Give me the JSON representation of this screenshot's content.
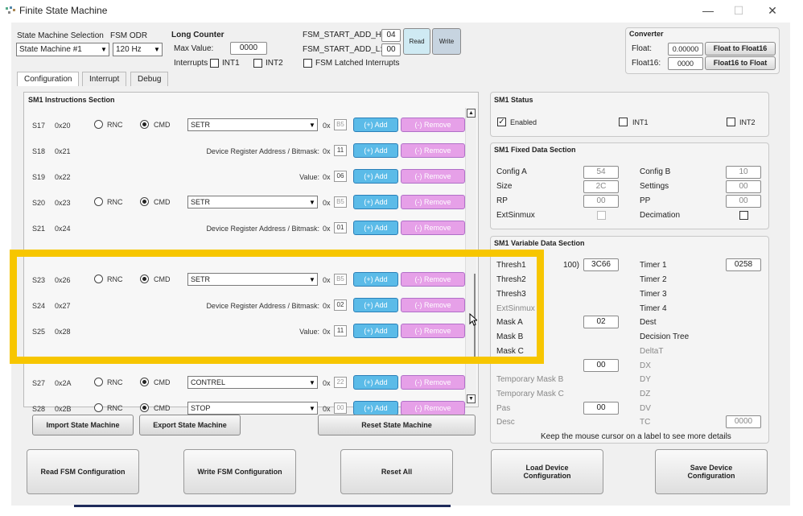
{
  "window": {
    "title": "Finite State Machine",
    "minimize": "—",
    "maximize": "☐",
    "close": "✕"
  },
  "top": {
    "sm_selection_label": "State Machine Selection",
    "sm_selection_value": "State Machine #1",
    "fsm_odr_label": "FSM ODR",
    "fsm_odr_value": "120 Hz",
    "long_counter_label": "Long Counter",
    "max_value_label": "Max Value:",
    "max_value": "0000",
    "interrupts_label": "Interrupts",
    "int1": "INT1",
    "int2": "INT2",
    "start_add_h_label": "FSM_START_ADD_H:",
    "start_add_h": "04",
    "start_add_l_label": "FSM_START_ADD_L:",
    "start_add_l": "00",
    "read_label": "Read",
    "write_label": "Write",
    "latched_label": "FSM Latched Interrupts",
    "converter_label": "Converter",
    "float_label": "Float:",
    "float_value": "0.00000",
    "float_btn": "Float to Float16",
    "float16_label": "Float16:",
    "float16_value": "0000",
    "float16_btn": "Float16 to Float"
  },
  "tabs": [
    "Configuration",
    "Interrupt",
    "Debug"
  ],
  "instructions": {
    "title": "SM1 Instructions Section",
    "rows": [
      {
        "id": "S17",
        "addr": "0x20",
        "type": "cmd",
        "cmd": "SETR",
        "hex": "B5"
      },
      {
        "id": "S18",
        "addr": "0x21",
        "type": "field",
        "field": "Device Register Address / Bitmask:",
        "hex": "11"
      },
      {
        "id": "S19",
        "addr": "0x22",
        "type": "field",
        "field": "Value:",
        "hex": "06"
      },
      {
        "id": "S20",
        "addr": "0x23",
        "type": "cmd",
        "cmd": "SETR",
        "hex": "B5"
      },
      {
        "id": "S21",
        "addr": "0x24",
        "type": "field",
        "field": "Device Register Address / Bitmask:",
        "hex": "01"
      },
      {
        "id": "S23",
        "addr": "0x26",
        "type": "cmd",
        "cmd": "SETR",
        "hex": "B5"
      },
      {
        "id": "S24",
        "addr": "0x27",
        "type": "field",
        "field": "Device Register Address / Bitmask:",
        "hex": "02"
      },
      {
        "id": "S25",
        "addr": "0x28",
        "type": "field",
        "field": "Value:",
        "hex": "11"
      },
      {
        "id": "S27",
        "addr": "0x2A",
        "type": "cmd",
        "cmd": "CONTREL",
        "hex": "22"
      },
      {
        "id": "S28",
        "addr": "0x2B",
        "type": "cmd",
        "cmd": "STOP",
        "hex": "00"
      }
    ],
    "rnc": "RNC",
    "cmd": "CMD",
    "ox": "0x",
    "add": "(+) Add",
    "remove": "(-) Remove"
  },
  "bottom_left": {
    "import": "Import State Machine",
    "export": "Export State Machine",
    "reset": "Reset State Machine"
  },
  "status": {
    "title": "SM1 Status",
    "enabled": "Enabled",
    "int1": "INT1",
    "int2": "INT2"
  },
  "fixed": {
    "title": "SM1 Fixed Data Section",
    "config_a": "Config A",
    "config_a_v": "54",
    "config_b": "Config B",
    "config_b_v": "10",
    "size": "Size",
    "size_v": "2C",
    "settings": "Settings",
    "settings_v": "00",
    "rp": "RP",
    "rp_v": "00",
    "pp": "PP",
    "pp_v": "00",
    "extsinmux": "ExtSinmux",
    "decimation": "Decimation"
  },
  "variable": {
    "title": "SM1 Variable Data Section",
    "thresh1": "Thresh1",
    "thresh1_suffix": "100)",
    "thresh1_v": "3C66",
    "timer1": "Timer 1",
    "timer1_v": "0258",
    "thresh2": "Thresh2",
    "timer2": "Timer 2",
    "thresh3": "Thresh3",
    "timer3": "Timer 3",
    "extsinmux": "ExtSinmux",
    "timer4": "Timer 4",
    "mask_a": "Mask A",
    "mask_a_v": "02",
    "dest": "Dest",
    "mask_b": "Mask B",
    "decision_tree": "Decision Tree",
    "mask_c": "Mask C",
    "deltat": "DeltaT",
    "v_blank1": "00",
    "dx": "DX",
    "temp_mask_b": "Temporary Mask B",
    "dy": "DY",
    "temp_mask_c": "Temporary Mask C",
    "dz": "DZ",
    "pas": "Pas",
    "pas_v": "00",
    "dv": "DV",
    "desc": "Desc",
    "tc": "TC",
    "tc_v": "0000",
    "hint": "Keep the mouse cursor on a label to see more details"
  },
  "actions": {
    "read": "Read FSM Configuration",
    "write": "Write FSM Configuration",
    "reset": "Reset All",
    "load": "Load Device Configuration",
    "save": "Save Device Configuration"
  },
  "colors": {
    "highlight": "#f7c600",
    "add": "#5bbbe8",
    "remove": "#e6a0e8"
  }
}
